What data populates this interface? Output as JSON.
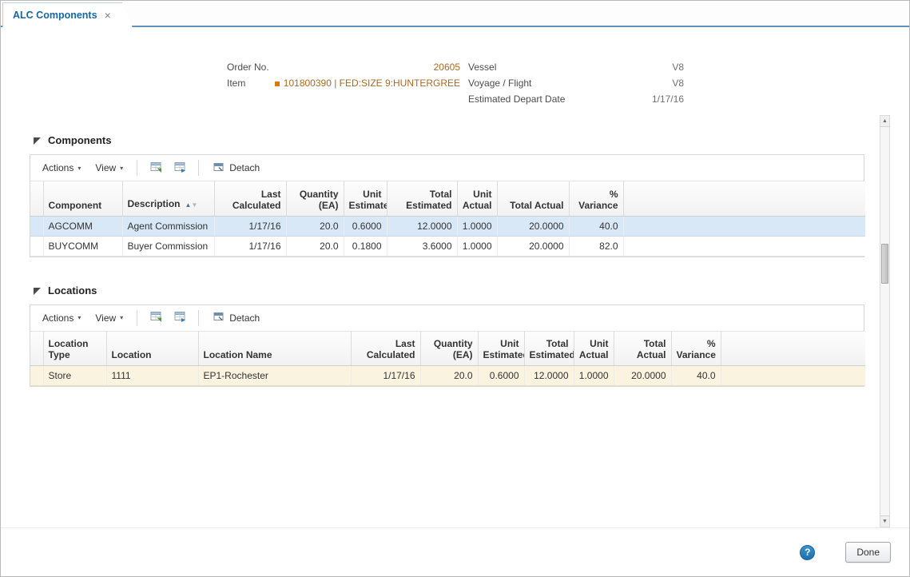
{
  "colors": {
    "accent_blue": "#19669e",
    "tab_underline": "#5f93bc",
    "selected_row": "#d9e8f6",
    "current_row_beige": "#faf3df",
    "item_value_orange": "#a96a25",
    "item_indicator_orange": "#e0780a",
    "help_icon_blue": "#1f6fad"
  },
  "tab": {
    "title": "ALC Components"
  },
  "icons": {
    "close": "×",
    "menu_caret": "▾",
    "sort_asc": "▲",
    "sort_desc": "▼",
    "scroll_up": "▲",
    "scroll_down": "▼",
    "help": "?"
  },
  "header": {
    "order_no": {
      "label": "Order No.",
      "value": "20605"
    },
    "item": {
      "label": "Item",
      "value": "101800390 | FED:SIZE 9:HUNTERGREE"
    },
    "vessel": {
      "label": "Vessel",
      "value": "V8"
    },
    "voyage": {
      "label": "Voyage / Flight",
      "value": "V8"
    },
    "depart": {
      "label": "Estimated Depart Date",
      "value": "1/17/16"
    }
  },
  "toolbar": {
    "actions": "Actions",
    "view": "View",
    "detach": "Detach"
  },
  "components": {
    "title": "Components",
    "columns": [
      "Component",
      "Description",
      "Last Calculated",
      "Quantity (EA)",
      "Unit Estimated",
      "Total Estimated",
      "Unit Actual",
      "Total Actual",
      "% Variance"
    ],
    "rows": [
      [
        "AGCOMM",
        "Agent Commission",
        "1/17/16",
        "20.0",
        "0.6000",
        "12.0000",
        "1.0000",
        "20.0000",
        "40.0"
      ],
      [
        "BUYCOMM",
        "Buyer Commission",
        "1/17/16",
        "20.0",
        "0.1800",
        "3.6000",
        "1.0000",
        "20.0000",
        "82.0"
      ]
    ]
  },
  "locations": {
    "title": "Locations",
    "columns": [
      "Location Type",
      "Location",
      "Location Name",
      "Last Calculated",
      "Quantity (EA)",
      "Unit Estimated",
      "Total Estimated",
      "Unit Actual",
      "Total Actual",
      "% Variance"
    ],
    "rows": [
      [
        "Store",
        "1111",
        "EP1-Rochester",
        "1/17/16",
        "20.0",
        "0.6000",
        "12.0000",
        "1.0000",
        "20.0000",
        "40.0"
      ]
    ]
  },
  "footer": {
    "done": "Done"
  }
}
